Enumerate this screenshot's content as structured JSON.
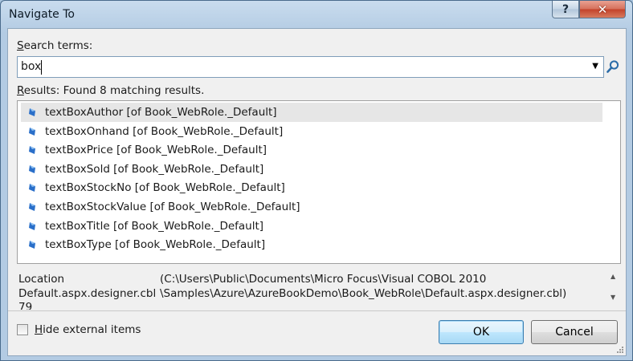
{
  "window": {
    "title": "Navigate To",
    "help_glyph": "?",
    "close_glyph": "✕"
  },
  "search": {
    "label_mnemonic": "S",
    "label_rest": "earch terms:",
    "value": "box"
  },
  "results": {
    "label_mnemonic": "R",
    "label_rest": "esults: Found 8 matching results.",
    "items": [
      "textBoxAuthor [of Book_WebRole._Default]",
      "textBoxOnhand [of Book_WebRole._Default]",
      "textBoxPrice [of Book_WebRole._Default]",
      "textBoxSold [of Book_WebRole._Default]",
      "textBoxStockNo [of Book_WebRole._Default]",
      "textBoxStockValue [of Book_WebRole._Default]",
      "textBoxTitle [of Book_WebRole._Default]",
      "textBoxType [of Book_WebRole._Default]"
    ],
    "selected_index": 0
  },
  "details": {
    "location_label": "Location",
    "file_name": "Default.aspx.designer.cbl",
    "line_partial": "79",
    "path_line1": "(C:\\Users\\Public\\Documents\\Micro Focus\\Visual COBOL 2010",
    "path_line2": "\\Samples\\Azure\\AzureBookDemo\\Book_WebRole\\Default.aspx.designer.cbl)"
  },
  "footer": {
    "checkbox_mnemonic": "H",
    "checkbox_rest": "ide external items",
    "checkbox_checked": false,
    "ok_label": "OK",
    "cancel_label": "Cancel"
  },
  "icons": {
    "help": "help-icon",
    "close": "close-icon",
    "dropdown": "chevron-down-icon",
    "search": "search-icon",
    "member": "field-member-icon"
  },
  "colors": {
    "titlebar": "#b3cbe3",
    "close_button": "#c3412a",
    "default_button_border": "#3c7fb1",
    "selection": "#e6e6e6",
    "member_icon": "#2a6fc9"
  }
}
